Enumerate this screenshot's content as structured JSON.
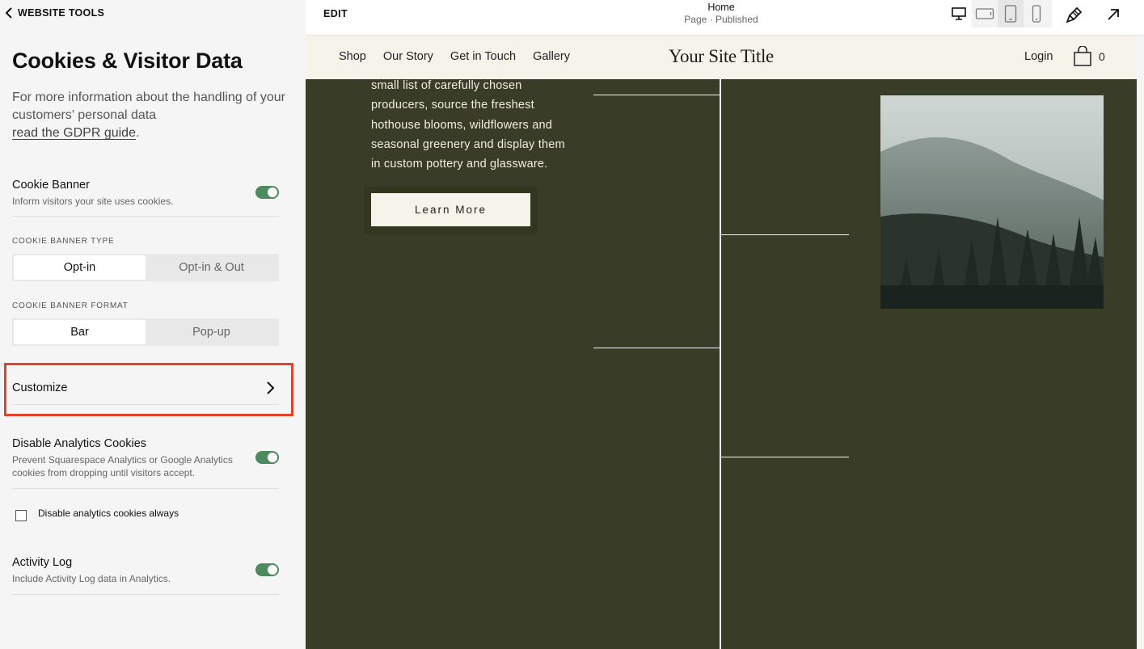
{
  "panel": {
    "back_label": "WEBSITE TOOLS",
    "title": "Cookies & Visitor Data",
    "description": "For more information about the handling of your customers’ personal data",
    "gdpr_link": "read the GDPR guide",
    "gdpr_suffix": ".",
    "cookie_banner": {
      "title": "Cookie Banner",
      "subtitle": "Inform visitors your site uses cookies.",
      "enabled": true
    },
    "banner_type": {
      "label": "COOKIE BANNER TYPE",
      "options": [
        "Opt-in",
        "Opt-in & Out"
      ],
      "selected": "Opt-in"
    },
    "banner_format": {
      "label": "COOKIE BANNER FORMAT",
      "options": [
        "Bar",
        "Pop-up"
      ],
      "selected": "Bar"
    },
    "customize_label": "Customize",
    "disable_analytics": {
      "title": "Disable Analytics Cookies",
      "subtitle": "Prevent Squarespace Analytics or Google Analytics cookies from dropping until visitors accept.",
      "enabled": true
    },
    "always_checkbox": {
      "label": "Disable analytics cookies always",
      "checked": false
    },
    "activity_log": {
      "title": "Activity Log",
      "subtitle": "Include Activity Log data in Analytics.",
      "enabled": true
    }
  },
  "topbar": {
    "edit_label": "EDIT",
    "page_name": "Home",
    "page_status": "Page · Published",
    "device_icons": [
      "desktop-icon",
      "tablet-landscape-icon",
      "tablet-portrait-icon",
      "mobile-icon"
    ],
    "selected_device": "desktop-icon"
  },
  "site": {
    "nav": [
      "Shop",
      "Our Story",
      "Get in Touch",
      "Gallery"
    ],
    "title": "Your Site Title",
    "login_label": "Login",
    "cart_count": "0",
    "body_text": "small list of carefully chosen producers, source the freshest hothouse blooms, wildflowers and seasonal greenery and display them in custom pottery and glassware.",
    "button_label": "Learn More"
  },
  "colors": {
    "accent_toggle": "#4e8a5f",
    "highlight": "#e0432a",
    "site_background": "#393c27",
    "header_background": "#f6f3ea"
  }
}
